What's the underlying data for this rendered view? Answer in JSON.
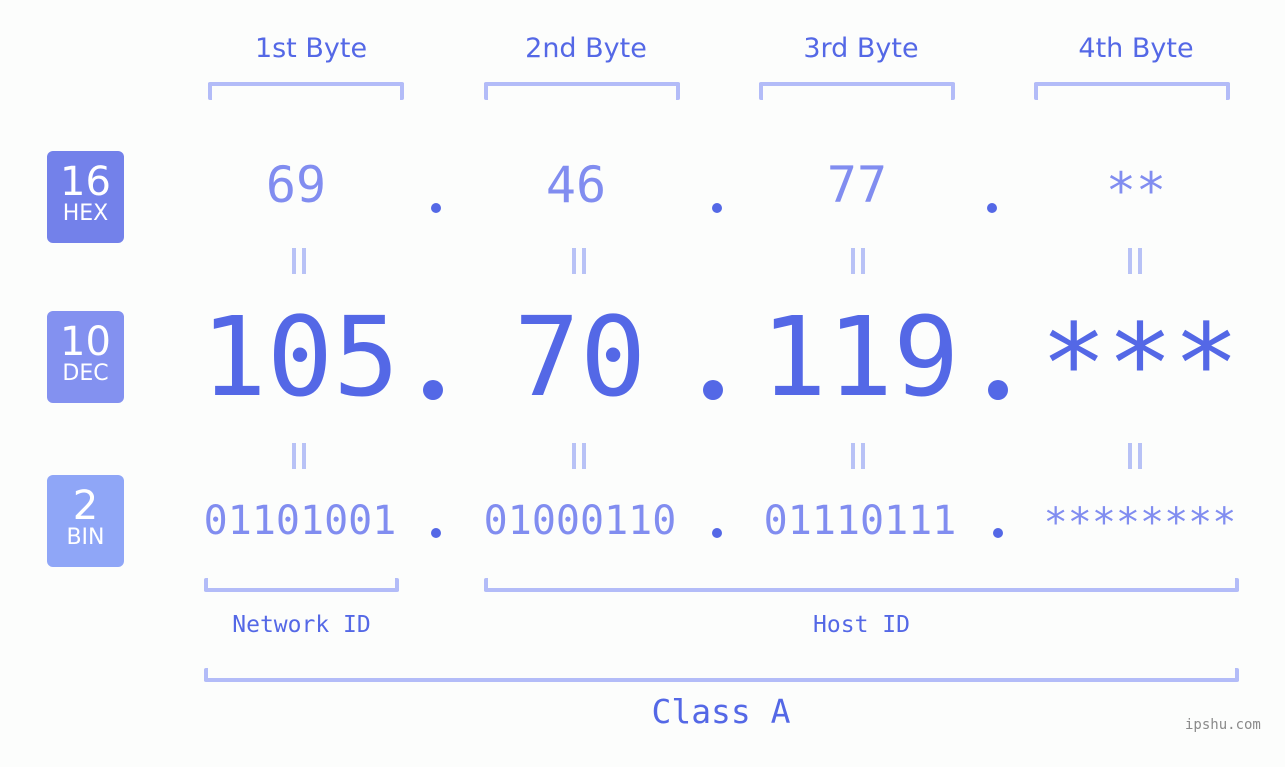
{
  "byte_headers": [
    "1st Byte",
    "2nd Byte",
    "3rd Byte",
    "4th Byte"
  ],
  "badges": {
    "hex": {
      "base": "16",
      "label": "HEX",
      "color": "#7381ea"
    },
    "dec": {
      "base": "10",
      "label": "DEC",
      "color": "#8391f0"
    },
    "bin": {
      "base": "2",
      "label": "BIN",
      "color": "#8fa6f7"
    }
  },
  "hex_values": [
    "69",
    "46",
    "77",
    "**"
  ],
  "dec_values": [
    "105",
    "70",
    "119",
    "***"
  ],
  "bin_values": [
    "01101001",
    "01000110",
    "01110111",
    "********"
  ],
  "separator": ".",
  "equals_symbol": "||",
  "network_id_label": "Network ID",
  "host_id_label": "Host ID",
  "class_label": "Class A",
  "footer": "ipshu.com",
  "colors": {
    "primary": "#5468e6",
    "secondary": "#818df0",
    "bracket": "#b3bcf8",
    "background": "#fcfdfc"
  }
}
